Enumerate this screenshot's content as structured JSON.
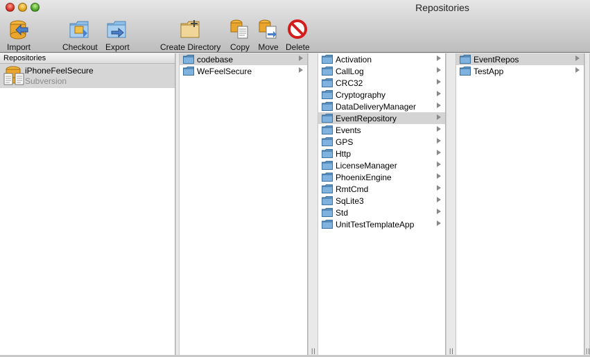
{
  "window": {
    "title": "Repositories"
  },
  "toolbar": {
    "import": "Import",
    "checkout": "Checkout",
    "export": "Export",
    "create_directory": "Create Directory",
    "copy": "Copy",
    "move": "Move",
    "delete": "Delete"
  },
  "repositories": {
    "header": "Repositories",
    "items": [
      {
        "name": "iPhoneFeelSecure",
        "type": "Subversion"
      }
    ]
  },
  "column1": {
    "items": [
      {
        "name": "codebase",
        "selected": true
      },
      {
        "name": "WeFeelSecure",
        "selected": false
      }
    ]
  },
  "column2": {
    "items": [
      {
        "name": "Activation"
      },
      {
        "name": "CallLog"
      },
      {
        "name": "CRC32"
      },
      {
        "name": "Cryptography"
      },
      {
        "name": "DataDeliveryManager"
      },
      {
        "name": "EventRepository",
        "selected": true
      },
      {
        "name": "Events"
      },
      {
        "name": "GPS"
      },
      {
        "name": "Http"
      },
      {
        "name": "LicenseManager"
      },
      {
        "name": "PhoenixEngine"
      },
      {
        "name": "RmtCmd"
      },
      {
        "name": "SqLite3"
      },
      {
        "name": "Std"
      },
      {
        "name": "UnitTestTemplateApp"
      }
    ]
  },
  "column3": {
    "items": [
      {
        "name": "EventRepos",
        "selected": true
      },
      {
        "name": "TestApp"
      }
    ]
  },
  "colors": {
    "selection": "#d4d4d4",
    "folder": "#7fb2de"
  }
}
